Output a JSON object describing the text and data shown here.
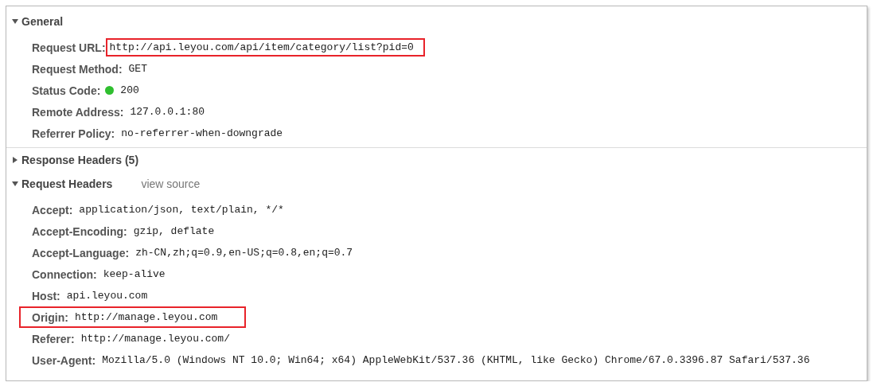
{
  "sections": [
    {
      "title": "General",
      "expanded": true,
      "rows": [
        {
          "kind": "text",
          "label": "Request URL:",
          "value": "http://api.leyou.com/api/item/category/list?pid=0",
          "value_boxed": true,
          "row_boxed": false
        },
        {
          "kind": "text",
          "label": "Request Method:",
          "value": "GET",
          "value_boxed": false,
          "row_boxed": false
        },
        {
          "kind": "status",
          "label": "Status Code:",
          "value": "200",
          "color": "#2fbf2f",
          "value_boxed": false,
          "row_boxed": false
        },
        {
          "kind": "text",
          "label": "Remote Address:",
          "value": "127.0.0.1:80",
          "value_boxed": false,
          "row_boxed": false
        },
        {
          "kind": "text",
          "label": "Referrer Policy:",
          "value": "no-referrer-when-downgrade",
          "value_boxed": false,
          "row_boxed": false
        }
      ]
    },
    {
      "title": "Response Headers (5)",
      "expanded": false
    },
    {
      "title": "Request Headers",
      "expanded": true,
      "link": "view source",
      "rows": [
        {
          "kind": "text",
          "label": "Accept:",
          "value": "application/json, text/plain, */*",
          "value_boxed": false,
          "row_boxed": false
        },
        {
          "kind": "text",
          "label": "Accept-Encoding:",
          "value": "gzip, deflate",
          "value_boxed": false,
          "row_boxed": false
        },
        {
          "kind": "text",
          "label": "Accept-Language:",
          "value": "zh-CN,zh;q=0.9,en-US;q=0.8,en;q=0.7",
          "value_boxed": false,
          "row_boxed": false
        },
        {
          "kind": "text",
          "label": "Connection:",
          "value": "keep-alive",
          "value_boxed": false,
          "row_boxed": false
        },
        {
          "kind": "text",
          "label": "Host:",
          "value": "api.leyou.com",
          "value_boxed": false,
          "row_boxed": false
        },
        {
          "kind": "text",
          "label": "Origin:",
          "value": "http://manage.leyou.com",
          "value_boxed": false,
          "row_boxed": true
        },
        {
          "kind": "text",
          "label": "Referer:",
          "value": "http://manage.leyou.com/",
          "value_boxed": false,
          "row_boxed": false
        },
        {
          "kind": "text",
          "label": "User-Agent:",
          "value": "Mozilla/5.0 (Windows NT 10.0; Win64; x64) AppleWebKit/537.36 (KHTML, like Gecko) Chrome/67.0.3396.87 Safari/537.36",
          "value_boxed": false,
          "row_boxed": false
        }
      ]
    }
  ]
}
